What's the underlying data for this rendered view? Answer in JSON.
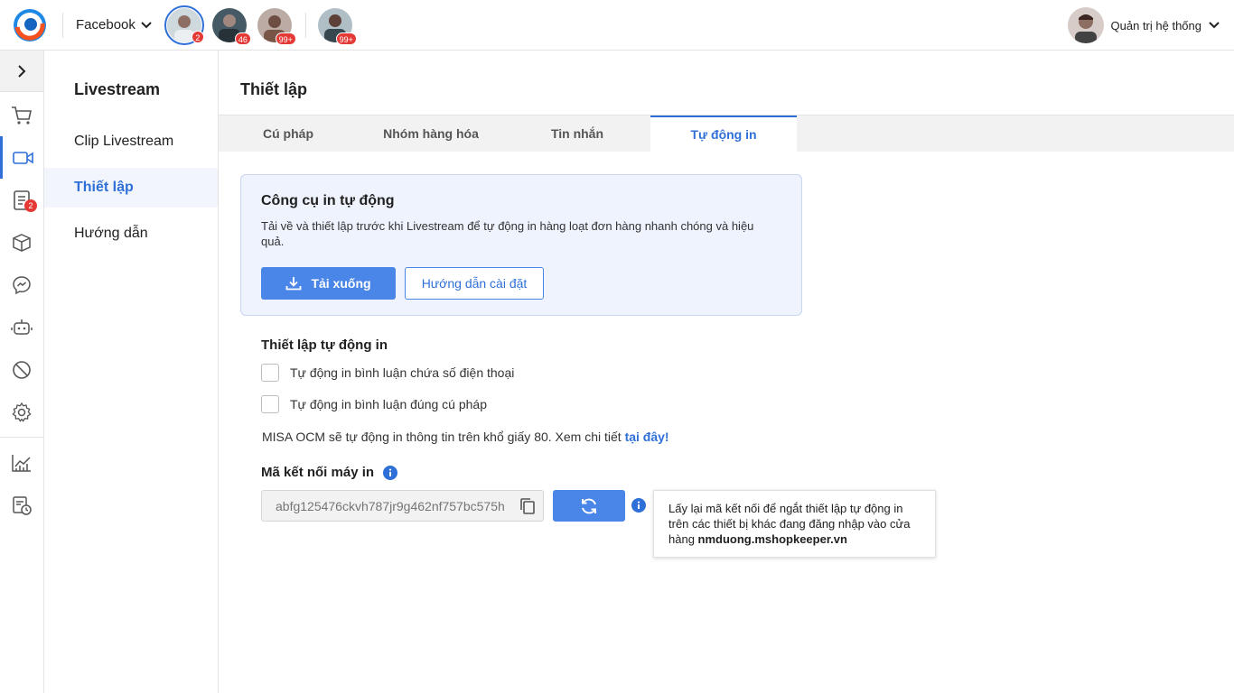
{
  "header": {
    "platform": "Facebook",
    "pages": [
      {
        "badge": "2",
        "active": true
      },
      {
        "badge": "46",
        "active": false
      },
      {
        "badge": "99+",
        "active": false
      },
      {
        "badge": "99+",
        "active": false
      }
    ],
    "user_name": "Quản trị hệ thống"
  },
  "rail": {
    "order_badge": "2"
  },
  "subnav": {
    "title": "Livestream",
    "items": [
      {
        "label": "Clip Livestream"
      },
      {
        "label": "Thiết lập"
      },
      {
        "label": "Hướng dẫn"
      }
    ]
  },
  "main": {
    "title": "Thiết lập",
    "tabs": [
      {
        "label": "Cú pháp"
      },
      {
        "label": "Nhóm hàng hóa"
      },
      {
        "label": "Tin nhắn"
      },
      {
        "label": "Tự động in"
      }
    ],
    "card": {
      "title": "Công cụ in tự động",
      "description": "Tải về và thiết lập trước khi Livestream để tự động in hàng loạt đơn hàng nhanh chóng và hiệu quả.",
      "download_label": "Tải xuống",
      "guide_label": "Hướng dẫn cài đặt"
    },
    "autoprint": {
      "title": "Thiết lập tự động in",
      "option_phone": "Tự động in bình luận chứa số điện thoại",
      "option_syntax": "Tự động in bình luận đúng cú pháp",
      "note": "MISA OCM sẽ tự động in thông tin trên khổ giấy 80. Xem chi tiết ",
      "note_link": "tại đây!"
    },
    "printer_code": {
      "title": "Mã kết nối máy in",
      "value": "abfg125476ckvh787jr9g462nf757bc575h",
      "tooltip_text": "Lấy lại mã kết nối để ngắt thiết lập tự động in trên các thiết bị khác đang đăng nhập vào cửa hàng ",
      "tooltip_shop": "nmduong.mshopkeeper.vn"
    }
  },
  "colors": {
    "accent": "#4a86e8",
    "brand_blue": "#2f6fd8",
    "badge_red": "#e53935"
  }
}
